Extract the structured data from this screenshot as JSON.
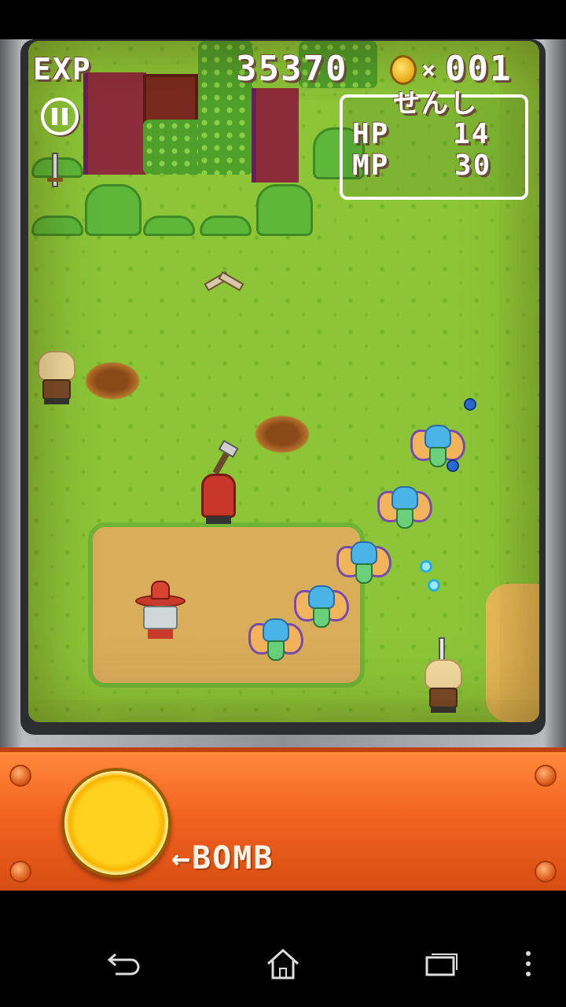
{
  "hud": {
    "exp_label": "EXP",
    "exp_value": "35370",
    "coin_multiplier": "×",
    "coin_count": "001",
    "class_name": "せんし",
    "hp_label": "HP",
    "hp_value": "14",
    "mp_label": "MP",
    "mp_value": "30"
  },
  "controls": {
    "bomb_label": "←BOMB"
  },
  "icons": {
    "pause": "pause-icon",
    "coin": "coin-icon",
    "back": "back-icon",
    "home": "home-icon",
    "recents": "recents-icon",
    "menu": "overflow-menu-icon"
  },
  "colors": {
    "grass": "#8cc637",
    "panel": "#f26420",
    "bomb_button": "#ffd21e",
    "frame": "#8e9194"
  }
}
